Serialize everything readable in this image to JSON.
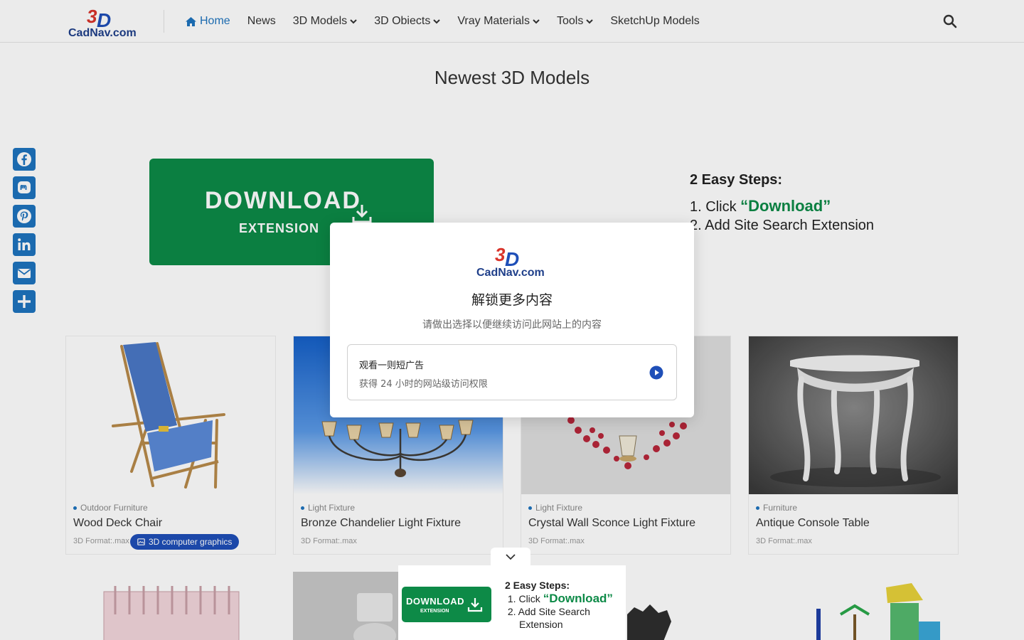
{
  "header": {
    "logo_text": "CadNav.com",
    "nav": [
      {
        "label": "Home",
        "icon": "home-icon",
        "active": true,
        "dropdown": false
      },
      {
        "label": "News",
        "dropdown": false
      },
      {
        "label": "3D Models",
        "dropdown": true
      },
      {
        "label": "3D Obiects",
        "dropdown": true
      },
      {
        "label": "Vray Materials",
        "dropdown": true
      },
      {
        "label": "Tools",
        "dropdown": true
      },
      {
        "label": "SketchUp Models",
        "dropdown": false
      }
    ],
    "search_icon": "search-icon"
  },
  "main": {
    "section_title": "Newest 3D Models",
    "ad": {
      "button_title": "DOWNLOAD",
      "button_sub": "EXTENSION",
      "steps_title": "2 Easy Steps:",
      "step1_prefix": "1. Click ",
      "step1_highlight": "“Download”",
      "step2": "2. Add Site Search Extension"
    },
    "cards": [
      {
        "category": "Outdoor Furniture",
        "title": "Wood Deck Chair",
        "format": "3D Format:.max",
        "tag": "3D computer graphics"
      },
      {
        "category": "Light Fixture",
        "title": "Bronze Chandelier Light Fixture",
        "format": "3D Format:.max"
      },
      {
        "category": "Light Fixture",
        "title": "Crystal Wall Sconce Light Fixture",
        "format": "3D Format:.max"
      },
      {
        "category": "Furniture",
        "title": "Antique Console Table",
        "format": "3D Format:.max"
      }
    ]
  },
  "social": [
    "facebook-icon",
    "mastodon-icon",
    "pinterest-icon",
    "linkedin-icon",
    "email-icon",
    "share-icon"
  ],
  "sticky_ad": {
    "button_title": "DOWNLOAD",
    "button_sub": "EXTENSION",
    "steps_title": "2 Easy Steps:",
    "step1_prefix": "1. Click ",
    "step1_highlight": "“Download”",
    "step2_line1": "2. Add Site Search",
    "step2_line2": "Extension"
  },
  "modal": {
    "title": "解锁更多内容",
    "subtitle": "请做出选择以便继续访问此网站上的内容",
    "option_title": "观看一则短广告",
    "option_desc": "获得 24 小时的网站级访问权限"
  },
  "colors": {
    "accent": "#1e73be",
    "download_green": "#0d8a47",
    "tag_blue": "#1f4fb8"
  }
}
